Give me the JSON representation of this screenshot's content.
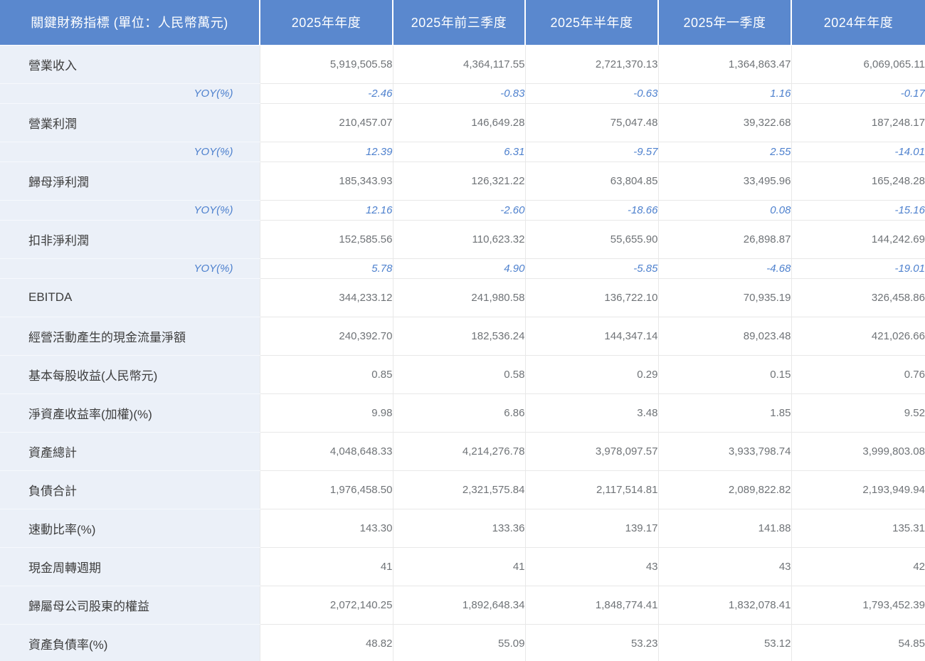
{
  "colors": {
    "header_bg": "#5A88CE",
    "header_text": "#FFFFFF",
    "label_col_bg": "#EBF0F8",
    "metric_text": "#3D3D3D",
    "value_text": "#6F7377",
    "yoy_text": "#4E81CE",
    "grid_line": "#E8E8E8"
  },
  "table": {
    "header": {
      "metric_label": "關鍵財務指標 (單位：人民幣萬元)",
      "columns": [
        "2025年年度",
        "2025年前三季度",
        "2025年半年度",
        "2025年一季度",
        "2024年年度"
      ]
    },
    "rows": [
      {
        "type": "metric",
        "label": "營業收入",
        "values": [
          "5,919,505.58",
          "4,364,117.55",
          "2,721,370.13",
          "1,364,863.47",
          "6,069,065.11"
        ]
      },
      {
        "type": "yoy",
        "label": "YOY(%)",
        "values": [
          "-2.46",
          "-0.83",
          "-0.63",
          "1.16",
          "-0.17"
        ]
      },
      {
        "type": "metric",
        "label": "營業利潤",
        "values": [
          "210,457.07",
          "146,649.28",
          "75,047.48",
          "39,322.68",
          "187,248.17"
        ]
      },
      {
        "type": "yoy",
        "label": "YOY(%)",
        "values": [
          "12.39",
          "6.31",
          "-9.57",
          "2.55",
          "-14.01"
        ]
      },
      {
        "type": "metric",
        "label": "歸母淨利潤",
        "values": [
          "185,343.93",
          "126,321.22",
          "63,804.85",
          "33,495.96",
          "165,248.28"
        ]
      },
      {
        "type": "yoy",
        "label": "YOY(%)",
        "values": [
          "12.16",
          "-2.60",
          "-18.66",
          "0.08",
          "-15.16"
        ]
      },
      {
        "type": "metric",
        "label": "扣非淨利潤",
        "values": [
          "152,585.56",
          "110,623.32",
          "55,655.90",
          "26,898.87",
          "144,242.69"
        ]
      },
      {
        "type": "yoy",
        "label": "YOY(%)",
        "values": [
          "5.78",
          "4.90",
          "-5.85",
          "-4.68",
          "-19.01"
        ]
      },
      {
        "type": "metric",
        "label": "EBITDA",
        "values": [
          "344,233.12",
          "241,980.58",
          "136,722.10",
          "70,935.19",
          "326,458.86"
        ]
      },
      {
        "type": "metric",
        "label": "經營活動產生的現金流量淨額",
        "values": [
          "240,392.70",
          "182,536.24",
          "144,347.14",
          "89,023.48",
          "421,026.66"
        ]
      },
      {
        "type": "metric",
        "label": "基本每股收益(人民幣元)",
        "values": [
          "0.85",
          "0.58",
          "0.29",
          "0.15",
          "0.76"
        ]
      },
      {
        "type": "metric",
        "label": "淨資產收益率(加權)(%)",
        "values": [
          "9.98",
          "6.86",
          "3.48",
          "1.85",
          "9.52"
        ]
      },
      {
        "type": "metric",
        "label": "資產總計",
        "values": [
          "4,048,648.33",
          "4,214,276.78",
          "3,978,097.57",
          "3,933,798.74",
          "3,999,803.08"
        ]
      },
      {
        "type": "metric",
        "label": "負債合計",
        "values": [
          "1,976,458.50",
          "2,321,575.84",
          "2,117,514.81",
          "2,089,822.82",
          "2,193,949.94"
        ]
      },
      {
        "type": "metric",
        "label": "速動比率(%)",
        "values": [
          "143.30",
          "133.36",
          "139.17",
          "141.88",
          "135.31"
        ]
      },
      {
        "type": "metric",
        "label": "現金周轉週期",
        "values": [
          "41",
          "41",
          "43",
          "43",
          "42"
        ]
      },
      {
        "type": "metric",
        "label": "歸屬母公司股東的權益",
        "values": [
          "2,072,140.25",
          "1,892,648.34",
          "1,848,774.41",
          "1,832,078.41",
          "1,793,452.39"
        ]
      },
      {
        "type": "metric",
        "label": "資產負債率(%)",
        "values": [
          "48.82",
          "55.09",
          "53.23",
          "53.12",
          "54.85"
        ]
      }
    ]
  }
}
